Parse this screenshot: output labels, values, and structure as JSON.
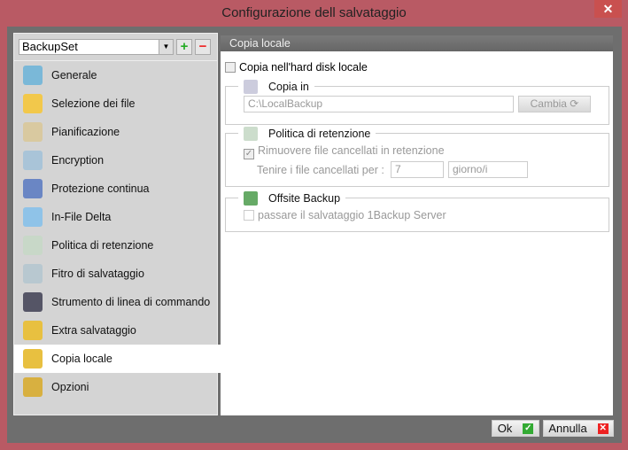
{
  "window": {
    "title": "Configurazione dell salvataggio",
    "close": "✕"
  },
  "sidebar": {
    "backupset": "BackupSet",
    "add": "+",
    "remove": "−",
    "items": [
      {
        "label": "Generale",
        "icon": "general-icon",
        "color": "#7ab8d8"
      },
      {
        "label": "Selezione dei file",
        "icon": "folder-icon",
        "color": "#f2c84b"
      },
      {
        "label": "Pianificazione",
        "icon": "schedule-icon",
        "color": "#d9c9a0"
      },
      {
        "label": "Encryption",
        "icon": "key-icon",
        "color": "#a9c4d8"
      },
      {
        "label": "Protezione continua",
        "icon": "shield-icon",
        "color": "#6a86c4"
      },
      {
        "label": "In-File Delta",
        "icon": "delta-icon",
        "color": "#8fc3e8"
      },
      {
        "label": "Politica di retenzione",
        "icon": "recycle-bin-icon",
        "color": "#c8d8c8"
      },
      {
        "label": "Fitro di salvataggio",
        "icon": "filter-icon",
        "color": "#b8c8d0"
      },
      {
        "label": "Strumento di linea di commando",
        "icon": "command-line-icon",
        "color": "#556"
      },
      {
        "label": "Extra salvataggio",
        "icon": "extra-backup-icon",
        "color": "#e8c040"
      },
      {
        "label": "Copia locale",
        "icon": "local-copy-icon",
        "color": "#e8c040"
      },
      {
        "label": "Opzioni",
        "icon": "options-icon",
        "color": "#d8b040"
      }
    ],
    "selected": 10
  },
  "main": {
    "header": "Copia locale",
    "local_copy_checkbox": "Copia nell'hard disk locale",
    "copy_in": {
      "title": "Copia in",
      "path": "C:\\LocalBackup",
      "change": "Cambia ⟳"
    },
    "retention": {
      "title": "Politica di retenzione",
      "remove_label": "Rimuovere file cancellati in retenzione",
      "keep_label": "Tenire i file cancellati per :",
      "days": "7",
      "unit": "giorno/i"
    },
    "offsite": {
      "title": "Offsite Backup",
      "checkbox": "passare il salvataggio 1Backup Server"
    }
  },
  "footer": {
    "ok": "Ok",
    "cancel": "Annulla"
  }
}
